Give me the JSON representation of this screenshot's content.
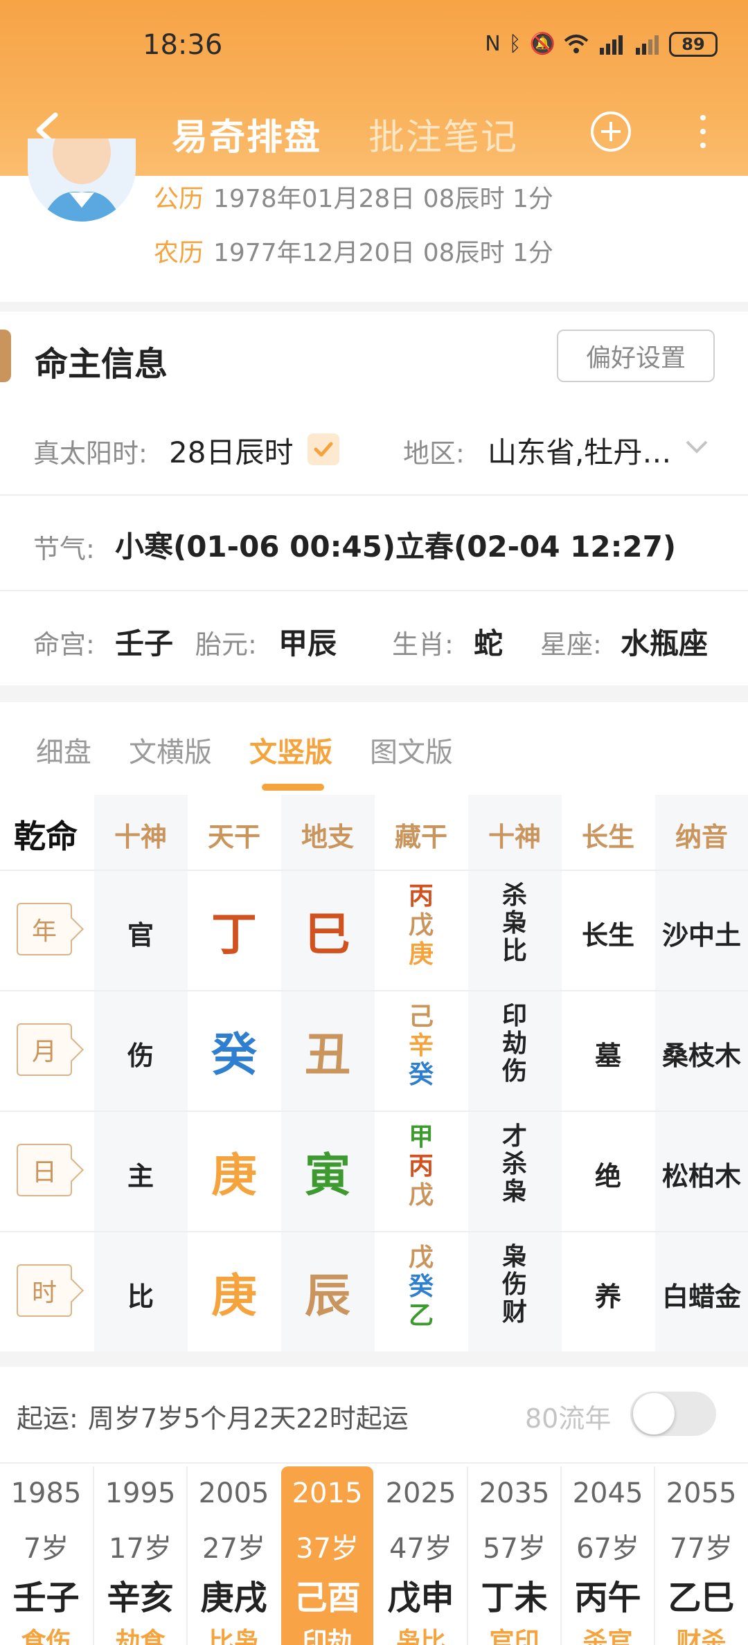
{
  "status": {
    "time": "18:36",
    "battery": "89"
  },
  "header": {
    "title": "易奇排盘",
    "notes_tab": "批注笔记"
  },
  "profile": {
    "solar_label": "公历",
    "solar": "1978年01月28日 08辰时 1分",
    "lunar_label": "农历",
    "lunar": "1977年12月20日 08辰时 1分"
  },
  "info": {
    "title": "命主信息",
    "pref_button": "偏好设置",
    "solar_time_label": "真太阳时:",
    "solar_time_value": "28日辰时",
    "region_label": "地区:",
    "region_value": "山东省,牡丹…",
    "jieqi_label": "节气:",
    "jieqi_value": "小寒(01-06 00:45)立春(02-04 12:27)",
    "minggong_label": "命宫:",
    "minggong": "壬子",
    "taiyuan_label": "胎元:",
    "taiyuan": "甲辰",
    "shengxiao_label": "生肖:",
    "shengxiao": "蛇",
    "xingzuo_label": "星座:",
    "xingzuo": "水瓶座"
  },
  "tabs": [
    "细盘",
    "文横版",
    "文竖版",
    "图文版"
  ],
  "chart": {
    "gender": "乾命",
    "headers": [
      "十神",
      "天干",
      "地支",
      "藏干",
      "十神",
      "长生",
      "纳音"
    ],
    "rows": [
      {
        "pillar": "年",
        "shishen": "官",
        "stem": "丁",
        "branch": "巳",
        "hidden": [
          "丙",
          "戊",
          "庚"
        ],
        "gods": [
          "杀",
          "枭",
          "比"
        ],
        "changsheng": "长生",
        "nayin": "沙中土"
      },
      {
        "pillar": "月",
        "shishen": "伤",
        "stem": "癸",
        "branch": "丑",
        "hidden": [
          "己",
          "辛",
          "癸"
        ],
        "gods": [
          "印",
          "劫",
          "伤"
        ],
        "changsheng": "墓",
        "nayin": "桑枝木"
      },
      {
        "pillar": "日",
        "shishen": "主",
        "stem": "庚",
        "branch": "寅",
        "hidden": [
          "甲",
          "丙",
          "戊"
        ],
        "gods": [
          "才",
          "杀",
          "枭"
        ],
        "changsheng": "绝",
        "nayin": "松柏木"
      },
      {
        "pillar": "时",
        "shishen": "比",
        "stem": "庚",
        "branch": "辰",
        "hidden": [
          "戊",
          "癸",
          "乙"
        ],
        "gods": [
          "枭",
          "伤",
          "财"
        ],
        "changsheng": "养",
        "nayin": "白蜡金"
      }
    ],
    "colors": {
      "fire": "#d2521f",
      "water": "#2f7fd0",
      "metal": "#f5a33d",
      "wood": "#3d9a2f",
      "earth": "#c9955c"
    }
  },
  "luck": {
    "start_label": "起运:",
    "start_value": "周岁7岁5个月2天22时起运",
    "flow_label": "80流年",
    "dayun": [
      {
        "year": "1985",
        "age": "7岁",
        "gz": "壬子",
        "tag": "食伤"
      },
      {
        "year": "1995",
        "age": "17岁",
        "gz": "辛亥",
        "tag": "劫食"
      },
      {
        "year": "2005",
        "age": "27岁",
        "gz": "庚戌",
        "tag": "比枭"
      },
      {
        "year": "2015",
        "age": "37岁",
        "gz": "己酉",
        "tag": "印劫"
      },
      {
        "year": "2025",
        "age": "47岁",
        "gz": "戊申",
        "tag": "枭比"
      },
      {
        "year": "2035",
        "age": "57岁",
        "gz": "丁未",
        "tag": "官印"
      },
      {
        "year": "2045",
        "age": "67岁",
        "gz": "丙午",
        "tag": "杀官"
      },
      {
        "year": "2055",
        "age": "77岁",
        "gz": "乙巳",
        "tag": "财杀"
      }
    ]
  }
}
